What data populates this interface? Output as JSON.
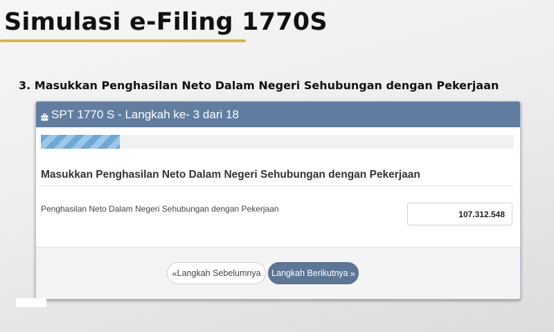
{
  "slide": {
    "title": "Simulasi e-Filing 1770S",
    "step_heading": "3. Masukkan Penghasilan Neto Dalam Negeri Sehubungan dengan Pekerjaan"
  },
  "window": {
    "header_title": "SPT 1770 S - Langkah ke- 3 dari 18",
    "progress_fraction": 0.1667,
    "section_title": "Masukkan Penghasilan Neto Dalam Negeri Sehubungan dengan Pekerjaan",
    "field": {
      "label": "Penghasilan Neto Dalam Negeri Sehubungan dengan Pekerjaan",
      "value": "107.312.548"
    },
    "buttons": {
      "prev_label": "Langkah Sebelumnya",
      "next_label": "Langkah Berikutnya"
    }
  },
  "colors": {
    "header_bg": "#617da0",
    "accent_underline": "#e0b43a",
    "next_button_bg": "#5d7696",
    "progress_stripe": "#6ea9d6"
  },
  "icons": {
    "header": "briefcase-icon",
    "prev": "double-chevron-left-icon",
    "next": "double-chevron-right-icon"
  }
}
